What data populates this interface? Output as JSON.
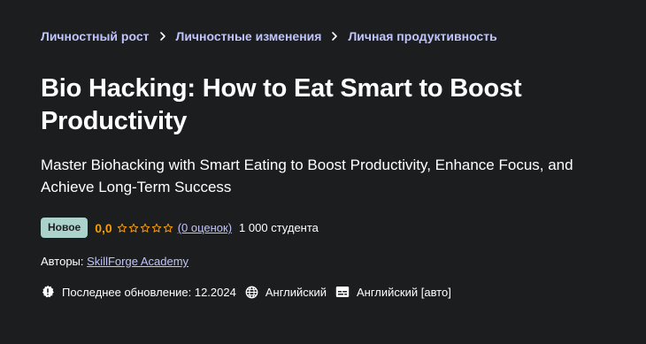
{
  "breadcrumb": {
    "items": [
      "Личностный рост",
      "Личностные изменения",
      "Личная продуктивность"
    ]
  },
  "course": {
    "title": "Bio Hacking: How to Eat Smart to Boost Productivity",
    "subtitle": "Master Biohacking with Smart Eating to Boost Productivity, Enhance Focus, and Achieve Long-Term Success",
    "badge": "Новое",
    "rating": "0,0",
    "stars_filled": 0,
    "stars_total": 5,
    "ratings_link": "(0 оценок)",
    "students": "1 000 студента",
    "authors_label": "Авторы:",
    "author_name": "SkillForge Academy",
    "last_updated": "Последнее обновление: 12.2024",
    "language": "Английский",
    "captions": "Английский [авто]"
  },
  "icons": {
    "breadcrumb_separator": "chevron-right-icon",
    "rating_star": "star-outline-icon",
    "update": "alert-badge-icon",
    "language": "globe-icon",
    "captions": "closed-captions-icon"
  },
  "colors": {
    "background": "#1c1d1f",
    "link": "#c0c4fc",
    "rating": "#f69c08",
    "badge_bg": "#acd2cc",
    "text": "#ffffff"
  }
}
